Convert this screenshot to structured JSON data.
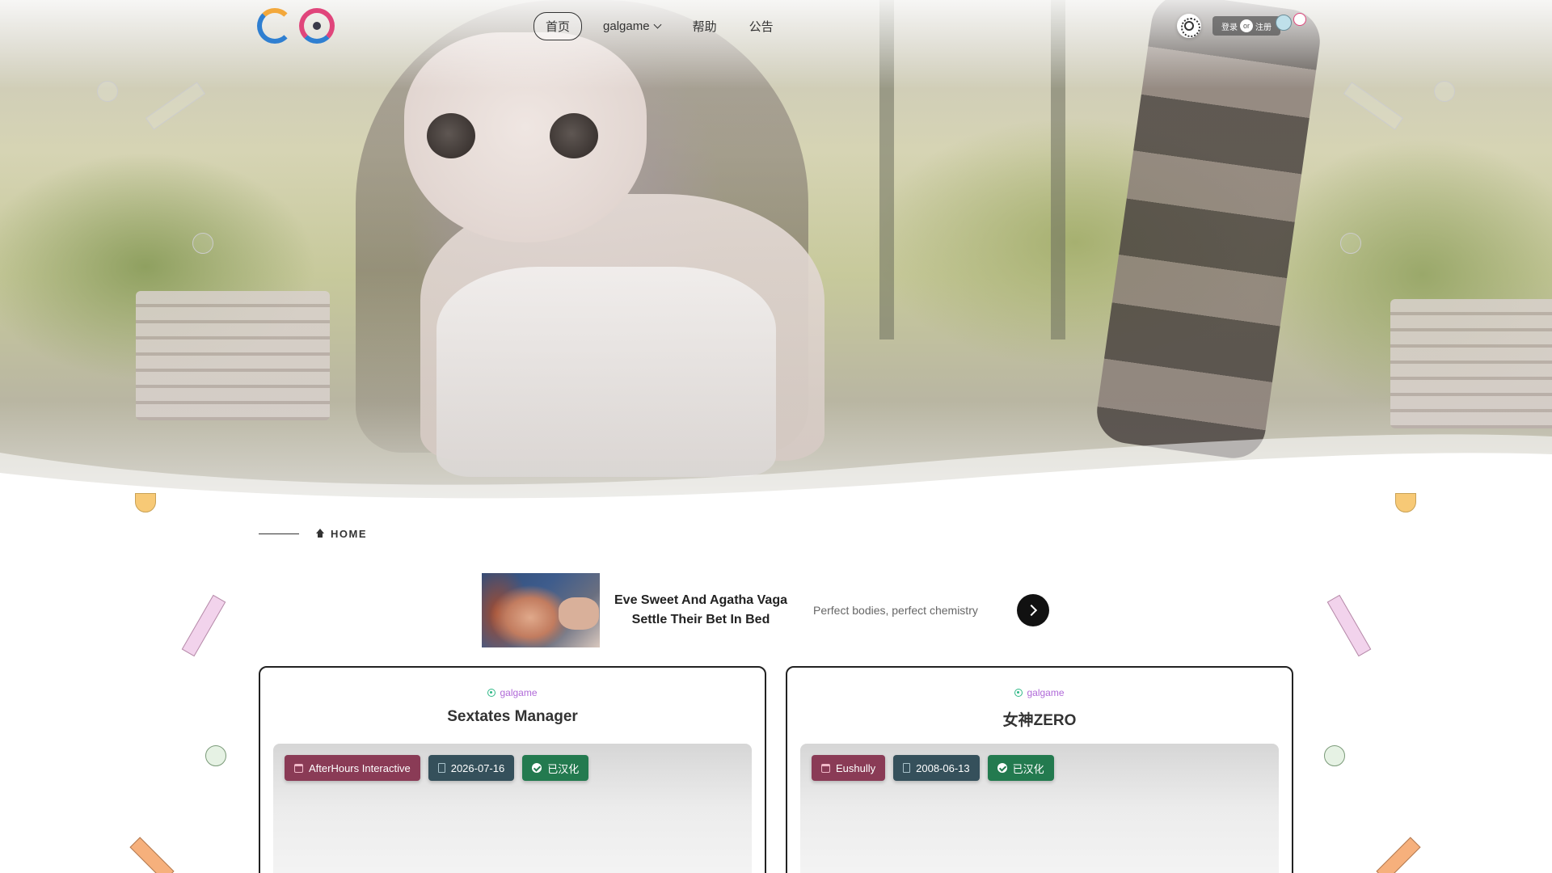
{
  "header": {
    "logo_alt": "GO",
    "nav": [
      {
        "label": "首页",
        "active": true
      },
      {
        "label": "galgame",
        "dropdown": true
      },
      {
        "label": "帮助"
      },
      {
        "label": "公告"
      }
    ],
    "auth": {
      "login": "登录",
      "or": "or",
      "register": "注册"
    },
    "icons": [
      "sun-icon",
      "mascot-icon"
    ]
  },
  "breadcrumb": {
    "label": "HOME",
    "icon": "home-icon"
  },
  "ad": {
    "title": "Eve Sweet And Agatha Vaga Settle Their Bet In Bed",
    "subtitle": "Perfect bodies, perfect chemistry",
    "icon": "chevron-right-icon"
  },
  "cards": [
    {
      "category": "galgame",
      "title": "Sextates Manager",
      "tags": {
        "publisher": "AfterHours Interactive",
        "date": "2026-07-16",
        "status": "已汉化"
      }
    },
    {
      "category": "galgame",
      "title": "女神ZERO",
      "tags": {
        "publisher": "Eushully",
        "date": "2008-06-13",
        "status": "已汉化"
      }
    }
  ],
  "colors": {
    "accent_purple": "#b06ad8",
    "tag_publisher": "#8a3b56",
    "tag_date": "#35505b",
    "tag_status": "#237a4f"
  }
}
